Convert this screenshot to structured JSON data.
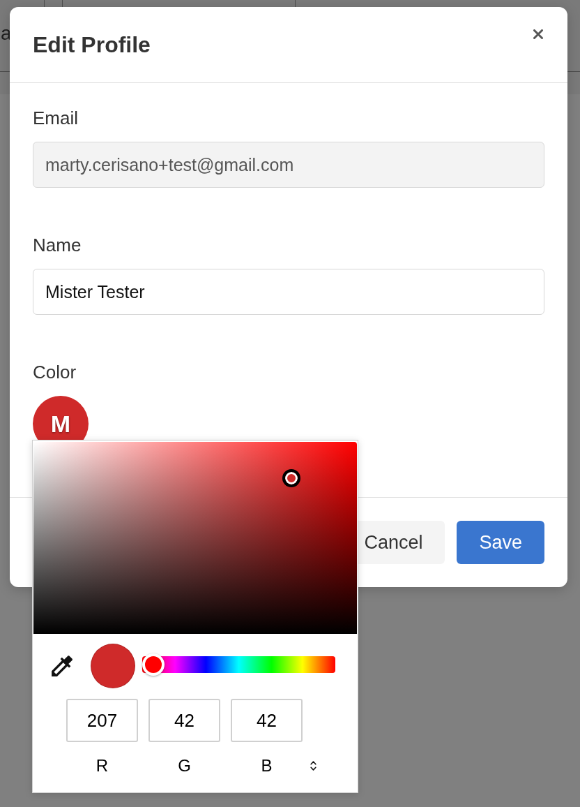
{
  "background": {
    "text": "a"
  },
  "dialog": {
    "title": "Edit Profile"
  },
  "fields": [
    {
      "kind": "text",
      "label": "Email",
      "value": "marty.cerisano+test@gmail.com",
      "disabled": true
    },
    {
      "kind": "text",
      "label": "Name",
      "value": "Mister Tester",
      "disabled": false
    },
    {
      "kind": "color",
      "label": "Color",
      "initial": "M"
    }
  ],
  "color_picker": {
    "hue": {
      "level": 0
    },
    "channels": [
      {
        "label": "R",
        "value": "207"
      },
      {
        "label": "G",
        "value": "42"
      },
      {
        "label": "B",
        "value": "42"
      }
    ]
  },
  "buttons": [
    {
      "kind": "secondary",
      "label": "Cancel"
    },
    {
      "kind": "primary",
      "label": "Save"
    }
  ]
}
